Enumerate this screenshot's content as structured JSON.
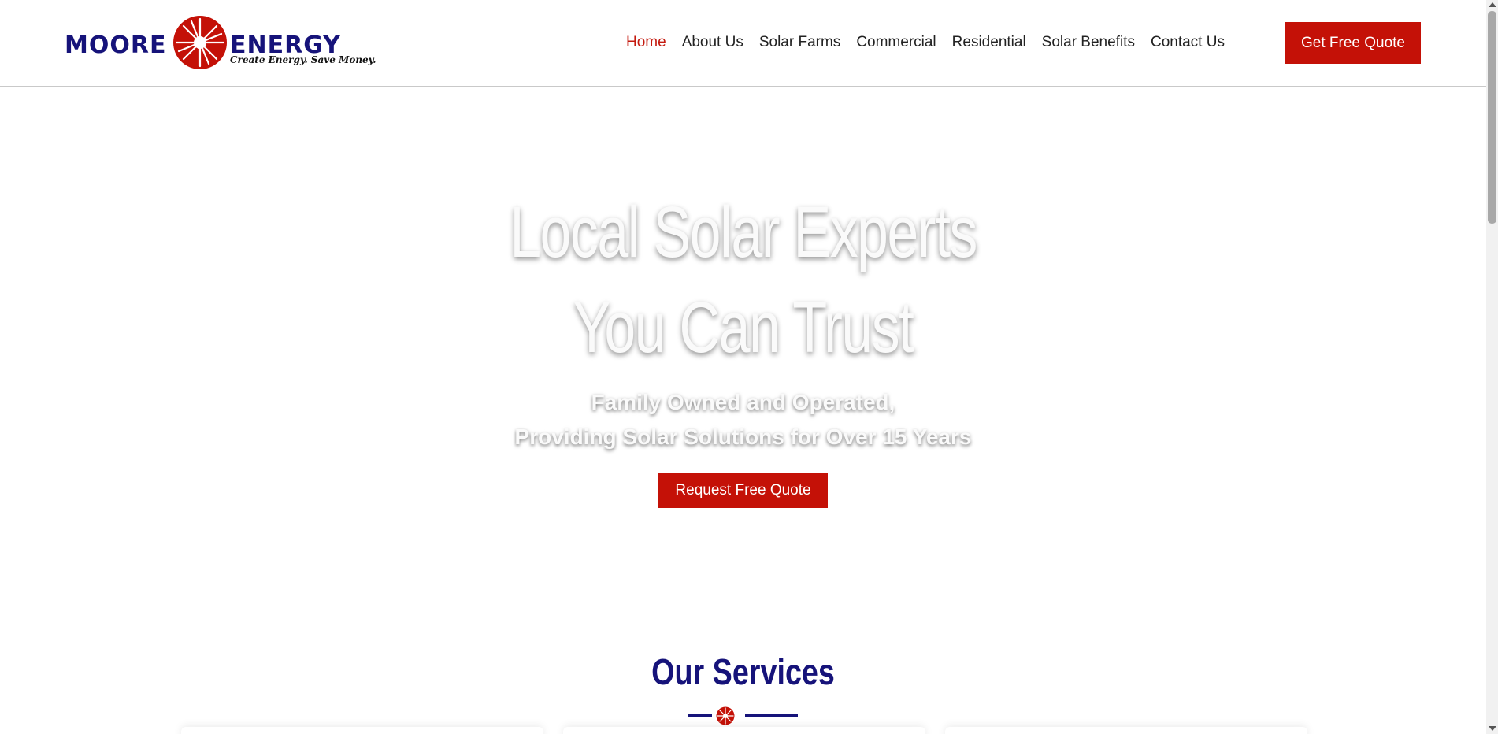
{
  "brand": {
    "name_left": "MOORE",
    "name_right": "ENERGY",
    "tagline": "Create Energy. Save Money.",
    "primary_color": "#16137a",
    "accent_color": "#c41107"
  },
  "nav": {
    "items": [
      {
        "label": "Home",
        "active": true
      },
      {
        "label": "About Us"
      },
      {
        "label": "Solar Farms"
      },
      {
        "label": "Commercial"
      },
      {
        "label": "Residential"
      },
      {
        "label": "Solar Benefits"
      },
      {
        "label": "Contact Us"
      }
    ],
    "cta_label": "Get Free Quote"
  },
  "hero": {
    "title_line1": "Local Solar Experts",
    "title_line2": "You Can Trust",
    "subtitle_line1": "Family Owned and Operated,",
    "subtitle_line2": "Providing Solar Solutions for Over 15 Years",
    "button_label": "Request Free Quote"
  },
  "services": {
    "title": "Our Services",
    "divider_icon": "sun-burst-icon"
  }
}
